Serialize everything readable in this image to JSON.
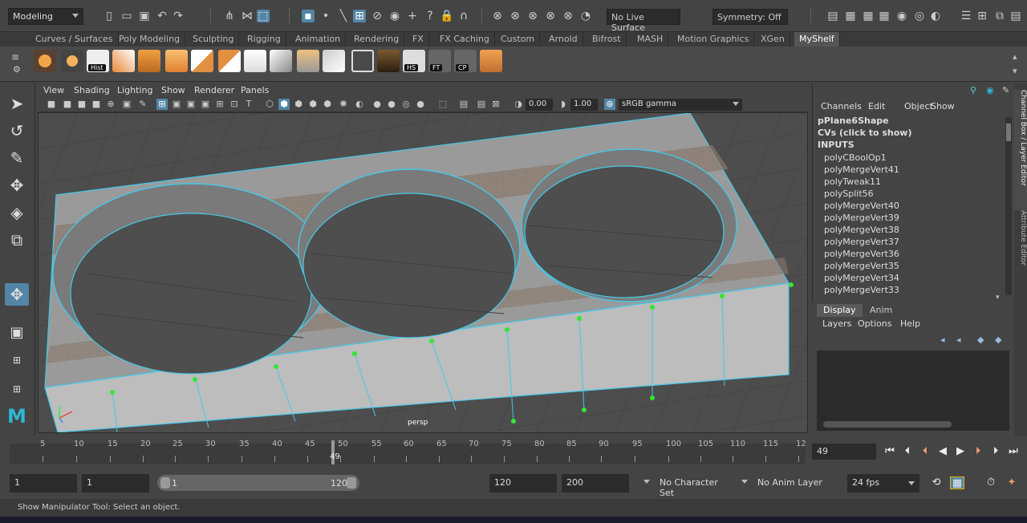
{
  "top": {
    "mode": "Modeling",
    "live_surface": "No Live Surface",
    "symmetry": "Symmetry: Off"
  },
  "shelf_tabs": [
    "Curves / Surfaces",
    "Poly Modeling",
    "Sculpting",
    "Rigging",
    "Animation",
    "Rendering",
    "FX",
    "FX Caching",
    "Custom",
    "Arnold",
    "Bifrost",
    "MASH",
    "Motion Graphics",
    "XGen",
    "MyShelf"
  ],
  "shelf": {
    "hist": "Hist",
    "hs": "HS",
    "ft": "FT",
    "cp": "CP"
  },
  "viewport": {
    "menu": [
      "View",
      "Shading",
      "Lighting",
      "Show",
      "Renderer",
      "Panels"
    ],
    "exposure": "0.00",
    "gamma": "1.00",
    "colorspace": "sRGB gamma",
    "camera": "persp"
  },
  "channelbox": {
    "menu": [
      "Channels",
      "Edit",
      "Object",
      "Show"
    ],
    "shape": "pPlane6Shape",
    "cvs": "CVs (click to show)",
    "inputs_label": "INPUTS",
    "inputs": [
      "polyCBoolOp1",
      "polyMergeVert41",
      "polyTweak11",
      "polySplit56",
      "polyMergeVert40",
      "polyMergeVert39",
      "polyMergeVert38",
      "polyMergeVert37",
      "polyMergeVert36",
      "polyMergeVert35",
      "polyMergeVert34",
      "polyMergeVert33"
    ]
  },
  "layers": {
    "tabs": [
      "Display",
      "Anim"
    ],
    "menu": [
      "Layers",
      "Options",
      "Help"
    ]
  },
  "side_tabs": [
    "Channel Box / Layer Editor",
    "Attribute Editor"
  ],
  "timeline": {
    "ticks": [
      "5",
      "10",
      "15",
      "20",
      "25",
      "30",
      "35",
      "40",
      "45",
      "50",
      "55",
      "60",
      "65",
      "70",
      "75",
      "80",
      "85",
      "90",
      "95",
      "100",
      "105",
      "110",
      "115",
      "12"
    ],
    "current": "49",
    "current_field": "49"
  },
  "range": {
    "start": "1",
    "start2": "1",
    "slider_start": "1",
    "slider_end": "120",
    "end": "120",
    "end2": "200",
    "char_set": "No Character Set",
    "anim_layer": "No Anim Layer",
    "fps": "24 fps"
  },
  "status": "Show Manipulator Tool: Select an object."
}
